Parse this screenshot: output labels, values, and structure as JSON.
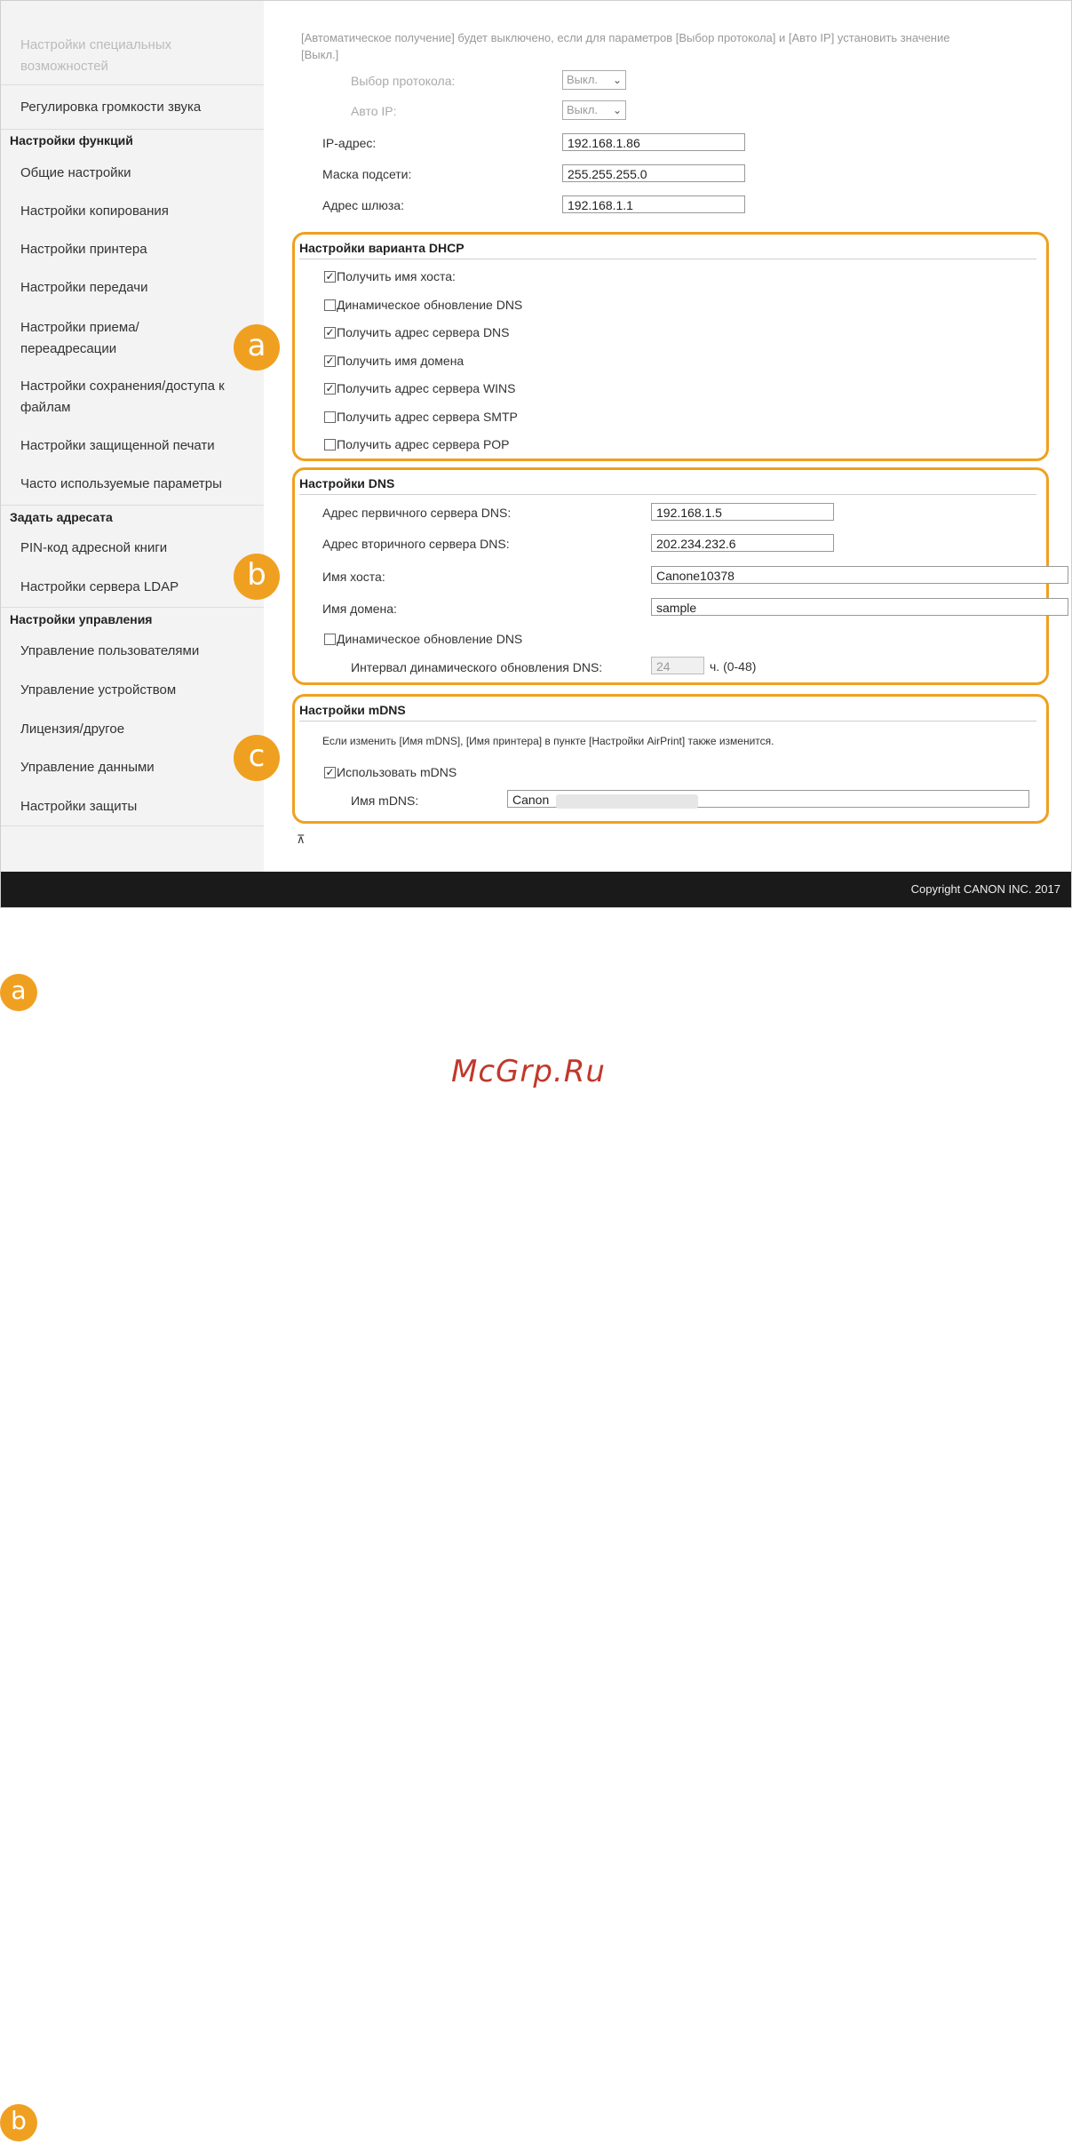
{
  "sidebar": {
    "items": [
      {
        "label": "Настройки специальных возможностей",
        "faded": true
      },
      {
        "label": "Регулировка громкости звука"
      },
      {
        "label": "Настройки функций",
        "heading": true
      },
      {
        "label": "Общие настройки"
      },
      {
        "label": "Настройки копирования"
      },
      {
        "label": "Настройки принтера"
      },
      {
        "label": "Настройки передачи"
      },
      {
        "label": "Настройки приема/переадресации"
      },
      {
        "label": "Настройки сохранения/доступа к файлам"
      },
      {
        "label": "Настройки защищенной печати"
      },
      {
        "label": "Часто используемые параметры"
      },
      {
        "label": "Задать адресата",
        "heading": true
      },
      {
        "label": "PIN-код адресной книги"
      },
      {
        "label": "Настройки сервера LDAP"
      },
      {
        "label": "Настройки управления",
        "heading": true
      },
      {
        "label": "Управление пользователями"
      },
      {
        "label": "Управление устройством"
      },
      {
        "label": "Лицензия/другое"
      },
      {
        "label": "Управление данными"
      },
      {
        "label": "Настройки защиты"
      }
    ]
  },
  "top": {
    "note": "[Автоматическое получение] будет выключено, если для параметров [Выбор протокола] и [Авто IP] установить значение [Выкл.]",
    "protocol_label": "Выбор протокола:",
    "protocol_value": "Выкл.",
    "autoip_label": "Авто IP:",
    "autoip_value": "Выкл.",
    "ip_label": "IP-адрес:",
    "ip_value": "192.168.1.86",
    "mask_label": "Маска подсети:",
    "mask_value": "255.255.255.0",
    "gateway_label": "Адрес шлюза:",
    "gateway_value": "192.168.1.1"
  },
  "dhcp": {
    "title": "Настройки варианта DHCP",
    "options": [
      {
        "label": "Получить имя хоста:",
        "checked": true
      },
      {
        "label": "Динамическое обновление DNS",
        "checked": false
      },
      {
        "label": "Получить адрес сервера DNS",
        "checked": true
      },
      {
        "label": "Получить имя домена",
        "checked": true
      },
      {
        "label": "Получить адрес сервера WINS",
        "checked": true
      },
      {
        "label": "Получить адрес сервера SMTP",
        "checked": false
      },
      {
        "label": "Получить адрес сервера POP",
        "checked": false
      }
    ]
  },
  "dns": {
    "title": "Настройки DNS",
    "primary_label": "Адрес первичного сервера DNS:",
    "primary_value": "192.168.1.5",
    "secondary_label": "Адрес вторичного сервера DNS:",
    "secondary_value": "202.234.232.6",
    "host_label": "Имя хоста:",
    "host_value": "Canone10378",
    "domain_label": "Имя домена:",
    "domain_value": "sample",
    "dynamic_label": "Динамическое обновление DNS",
    "interval_label": "Интервал динамического обновления DNS:",
    "interval_value": "24",
    "interval_unit": "ч. (0-48)"
  },
  "mdns": {
    "title": "Настройки mDNS",
    "note": "Если изменить [Имя mDNS], [Имя принтера] в пункте [Настройки AirPrint] также изменится.",
    "use_label": "Использовать mDNS",
    "name_label": "Имя mDNS:",
    "name_value": "Canon"
  },
  "badges": {
    "a": "a",
    "b": "b",
    "c": "c"
  },
  "footer": {
    "copyright": "Copyright CANON INC. 2017"
  },
  "watermark": "McGrp.Ru",
  "colors": {
    "accent": "#f0a020",
    "footer": "#1a1a1a"
  }
}
